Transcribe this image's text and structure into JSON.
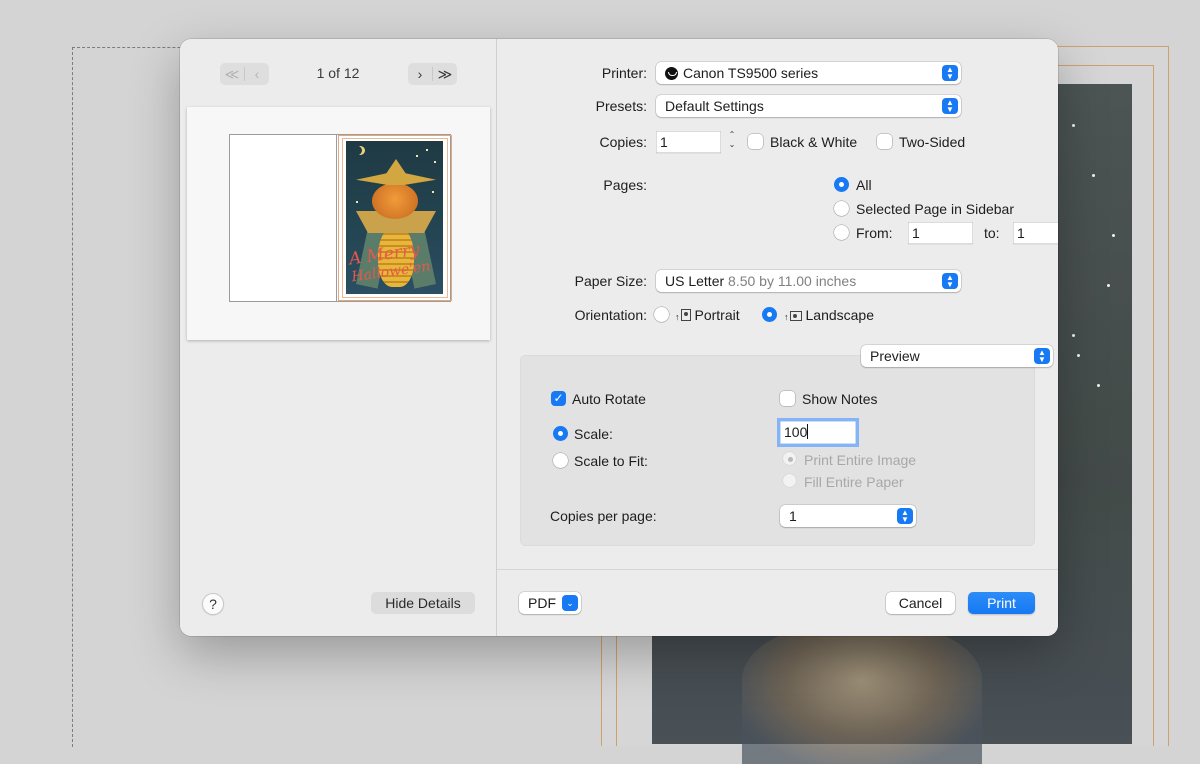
{
  "navigation": {
    "first_page": "≪",
    "prev_page": "‹",
    "next_page": "›",
    "last_page": "≫",
    "page_indicator": "1 of 12"
  },
  "preview": {
    "card_text_line1": "A Merry",
    "card_text_line2": "Hallowe'en"
  },
  "left_footer": {
    "help": "?",
    "hide_details": "Hide Details"
  },
  "printer": {
    "label": "Printer:",
    "value": "Canon TS9500 series"
  },
  "presets": {
    "label": "Presets:",
    "value": "Default Settings"
  },
  "copies": {
    "label": "Copies:",
    "value": "1",
    "black_white": {
      "label": "Black & White",
      "checked": false
    },
    "two_sided": {
      "label": "Two-Sided",
      "checked": false
    }
  },
  "pages": {
    "label": "Pages:",
    "options": [
      "All",
      "Selected Page in Sidebar",
      "From:"
    ],
    "selected": "All",
    "from_value": "1",
    "to_label": "to:",
    "to_value": "1"
  },
  "paper_size": {
    "label": "Paper Size:",
    "value": "US Letter",
    "detail": "8.50 by 11.00 inches"
  },
  "orientation": {
    "label": "Orientation:",
    "portrait": "Portrait",
    "landscape": "Landscape",
    "selected": "Landscape"
  },
  "section_popup": {
    "value": "Preview"
  },
  "preview_options": {
    "auto_rotate": {
      "label": "Auto Rotate",
      "checked": true
    },
    "show_notes": {
      "label": "Show Notes",
      "checked": false
    },
    "scale_label": "Scale:",
    "scale_value": "100",
    "scale_to_fit_label": "Scale to Fit:",
    "print_entire_image": "Print Entire Image",
    "fill_entire_paper": "Fill Entire Paper",
    "copies_per_page_label": "Copies per page:",
    "copies_per_page_value": "1"
  },
  "footer": {
    "pdf": "PDF",
    "cancel": "Cancel",
    "print": "Print"
  },
  "colors": {
    "accent": "#1779f4",
    "dialog_bg": "#ececec",
    "desktop_bg": "#d4d4d4"
  }
}
